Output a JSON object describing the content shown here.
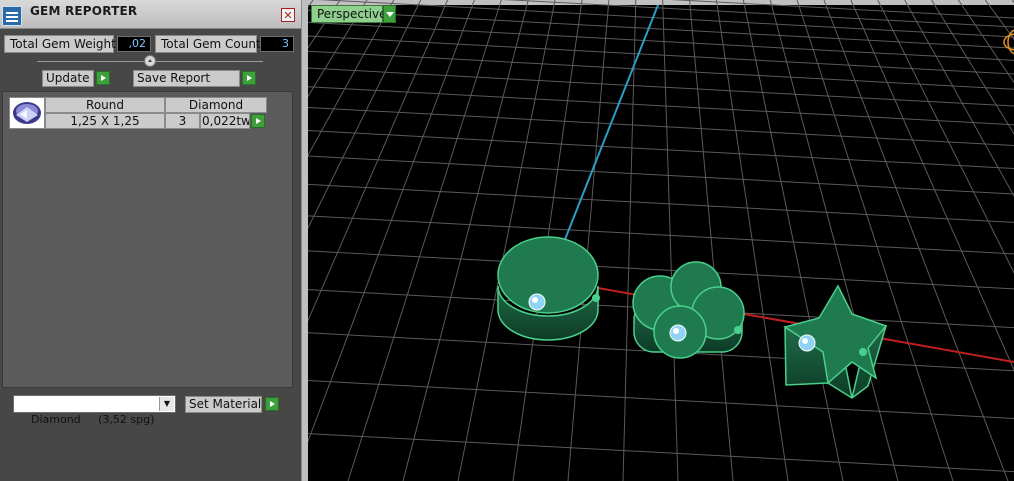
{
  "panel": {
    "title": "GEM REPORTER",
    "close_glyph": "✕",
    "total_weight_label": "Total Gem Weight",
    "total_weight_value": ",02",
    "total_count_label": "Total Gem Count",
    "total_count_value": "3",
    "update_label": "Update",
    "save_report_label": "Save Report",
    "table": {
      "headers": [
        "Round",
        "Diamond"
      ],
      "rows": [
        {
          "size": "1,25 X 1,25",
          "count": "3",
          "weight": "0,022tw"
        }
      ]
    },
    "material": {
      "selected": "Diamond     (3,52 spg)"
    },
    "set_material_label": "Set Material"
  },
  "viewport": {
    "view_label": "Perspective",
    "objects": [
      "cylinder-ring",
      "clover-ring",
      "star-ring"
    ]
  },
  "colors": {
    "panel_bg": "#474747",
    "report_bg": "#5b5b5b",
    "value_text": "#7fc4ff",
    "accent_green": "#3da03d",
    "model_green": "#1f7a4f",
    "grid": "#5a5a5a",
    "axis_red": "#c02020",
    "axis_blue": "#2aa0c0"
  },
  "icons": [
    "app-icon",
    "close-icon",
    "slider-knob-icon",
    "play-icon",
    "gem-thumbnail-icon",
    "chevron-down-icon"
  ]
}
